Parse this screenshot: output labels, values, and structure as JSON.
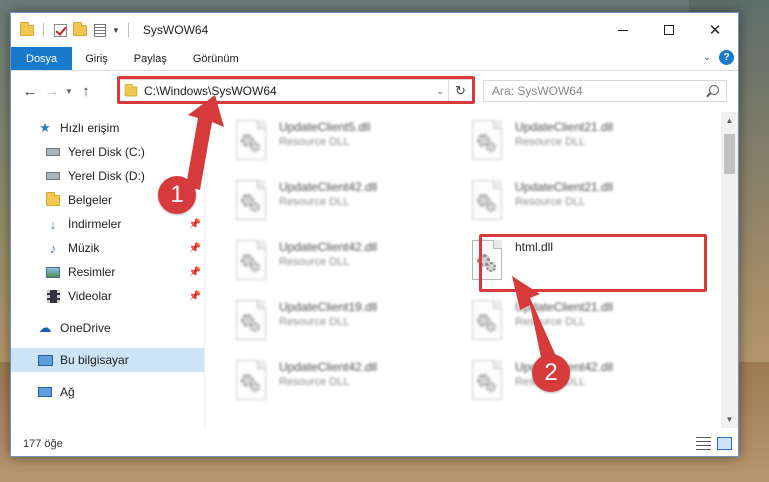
{
  "window": {
    "title": "SysWOW64"
  },
  "ribbon": {
    "tabs": [
      "Dosya",
      "Giriş",
      "Paylaş",
      "Görünüm"
    ],
    "help": "?"
  },
  "address": {
    "path": "C:\\Windows\\SysWOW64",
    "search_placeholder": "Ara: SysWOW64"
  },
  "nav": {
    "items": [
      {
        "label": "Hızlı erişim",
        "icon": "star-icon",
        "pinned": false
      },
      {
        "label": "Yerel Disk (C:)",
        "icon": "drive-icon",
        "pinned": false
      },
      {
        "label": "Yerel Disk (D:)",
        "icon": "drive-icon",
        "pinned": false
      },
      {
        "label": "Belgeler",
        "icon": "documents-icon",
        "pinned": false
      },
      {
        "label": "İndirmeler",
        "icon": "download-icon",
        "pinned": true
      },
      {
        "label": "Müzik",
        "icon": "music-icon",
        "pinned": true
      },
      {
        "label": "Resimler",
        "icon": "pictures-icon",
        "pinned": true
      },
      {
        "label": "Videolar",
        "icon": "videos-icon",
        "pinned": true
      },
      {
        "label": "OneDrive",
        "icon": "cloud-icon",
        "pinned": false
      },
      {
        "label": "Bu bilgisayar",
        "icon": "computer-icon",
        "pinned": false
      },
      {
        "label": "Ağ",
        "icon": "network-icon",
        "pinned": false
      }
    ]
  },
  "files": [
    {
      "name": "UpdateClient5.dll",
      "type": "Resource DLL"
    },
    {
      "name": "UpdateClient21.dll",
      "type": "Resource DLL"
    },
    {
      "name": "UpdateClient42.dll",
      "type": "Resource DLL"
    },
    {
      "name": "UpdateClient21.dll",
      "type": "Resource DLL"
    },
    {
      "name": "UpdateClient42.dll",
      "type": "Resource DLL"
    },
    {
      "name": "html.dll",
      "type": ""
    },
    {
      "name": "UpdateClient19.dll",
      "type": "Resource DLL"
    },
    {
      "name": "UpdateClient21.dll",
      "type": "Resource DLL"
    },
    {
      "name": "UpdateClient42.dll",
      "type": "Resource DLL"
    },
    {
      "name": "UpdateClient42.dll",
      "type": "Resource DLL"
    }
  ],
  "status": {
    "item_count": "177 öğe"
  },
  "callouts": [
    "1",
    "2"
  ],
  "colors": {
    "accent": "#1979ca",
    "highlight": "#d63a3a",
    "selected_nav": "#cce4f7"
  }
}
